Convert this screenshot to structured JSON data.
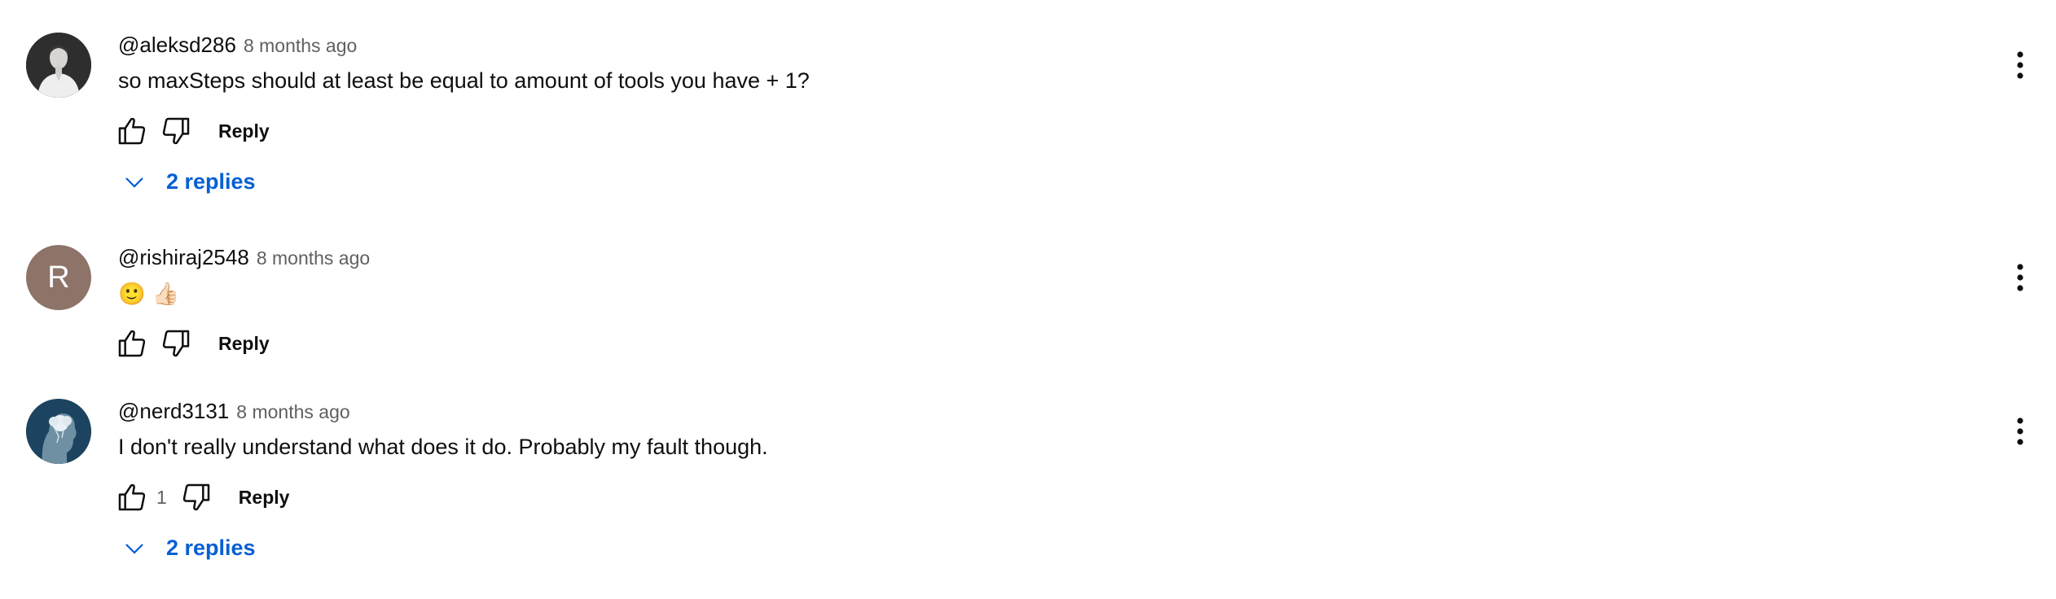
{
  "comments": [
    {
      "author": "@aleksd286",
      "time": "8 months ago",
      "text": "so maxSteps should at least be equal to amount of tools you have + 1?",
      "like_count": "",
      "reply_label": "Reply",
      "replies_label": "2 replies",
      "avatar_icon": "person-photo-avatar"
    },
    {
      "author": "@rishiraj2548",
      "time": "8 months ago",
      "emojis": [
        "🙂",
        "👍🏻"
      ],
      "avatar_letter": "R",
      "reply_label": "Reply"
    },
    {
      "author": "@nerd3131",
      "time": "8 months ago",
      "text": "I don't really understand what does it do. Probably my fault though.",
      "like_count": "1",
      "reply_label": "Reply",
      "replies_label": "2 replies",
      "avatar_icon": "head-silhouette-avatar"
    }
  ],
  "colors": {
    "link_blue": "#065fd4",
    "meta_gray": "#606060",
    "letter_avatar_bg": "#8d7368"
  },
  "icons": [
    "thumbs-up-icon",
    "thumbs-down-icon",
    "chevron-down-icon",
    "more-vert-icon"
  ]
}
